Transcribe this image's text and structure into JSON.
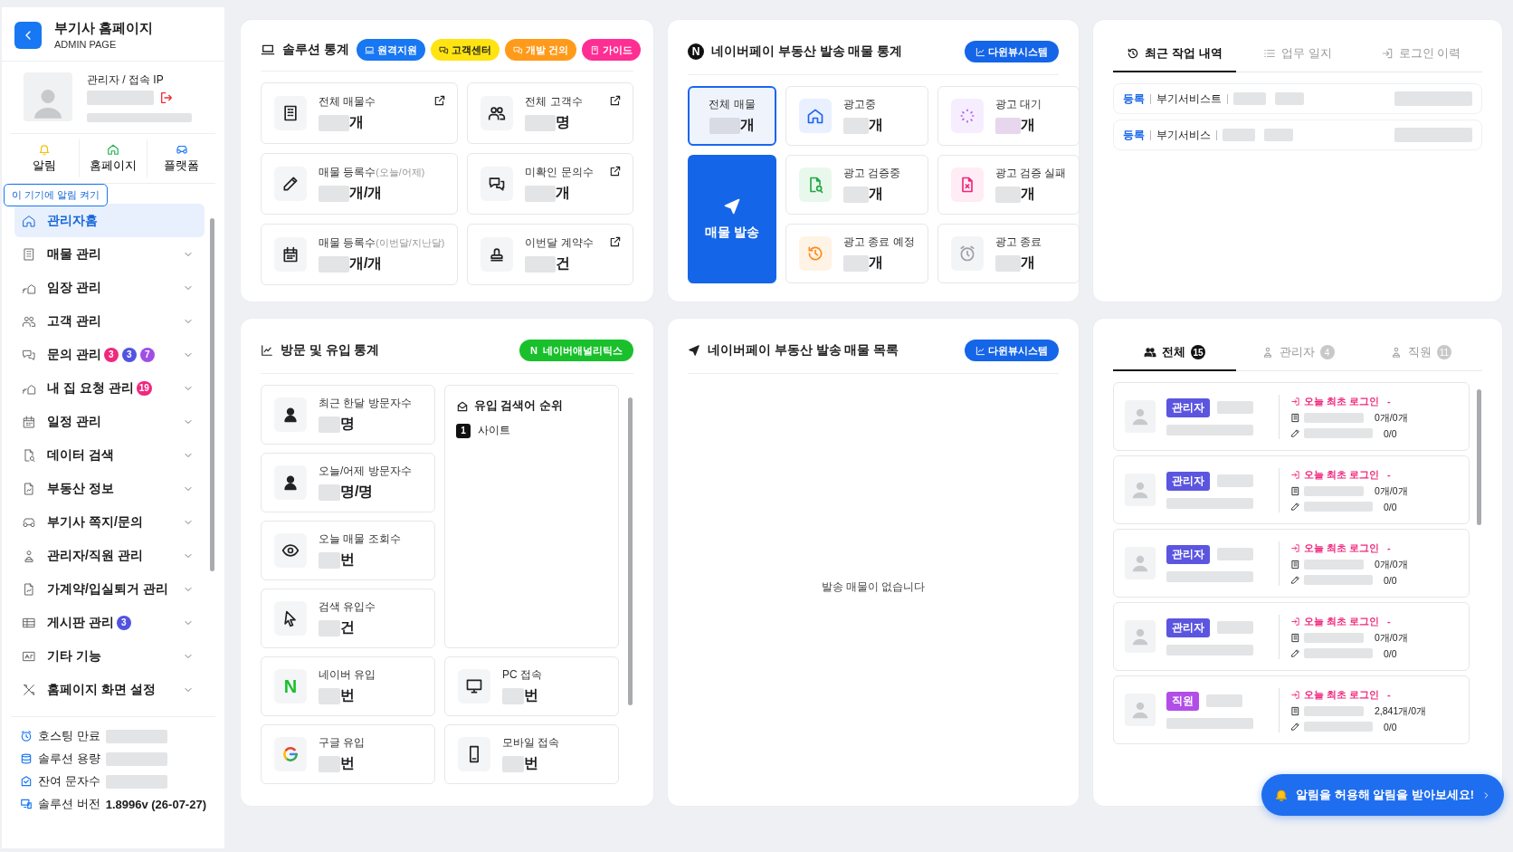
{
  "sidebar": {
    "title": "부기사 홈페이지",
    "subtitle": "ADMIN PAGE",
    "profile": {
      "label": "관리자 / 접속 IP"
    },
    "quick_nav": [
      {
        "label": "알림"
      },
      {
        "label": "홈페이지"
      },
      {
        "label": "플랫폼"
      }
    ],
    "tooltip": "이 기기에 알림 켜기",
    "items": [
      {
        "label": "관리자홈",
        "selected": true,
        "expandable": false
      },
      {
        "label": "매물 관리",
        "selected": false,
        "expandable": true
      },
      {
        "label": "임장 관리",
        "selected": false,
        "expandable": true
      },
      {
        "label": "고객 관리",
        "selected": false,
        "expandable": true
      },
      {
        "label": "문의 관리",
        "selected": false,
        "expandable": true,
        "badges": [
          {
            "count": "3",
            "color": "#f0287d"
          },
          {
            "count": "3",
            "color": "#5254e0"
          },
          {
            "count": "7",
            "color": "#a04ee6"
          }
        ]
      },
      {
        "label": "내 집 요청 관리",
        "selected": false,
        "expandable": true,
        "badges": [
          {
            "count": "19",
            "color": "#f0287d"
          }
        ]
      },
      {
        "label": "일정 관리",
        "selected": false,
        "expandable": true
      },
      {
        "label": "데이터 검색",
        "selected": false,
        "expandable": true
      },
      {
        "label": "부동산 정보",
        "selected": false,
        "expandable": true
      },
      {
        "label": "부기사 쪽지/문의",
        "selected": false,
        "expandable": true
      },
      {
        "label": "관리자/직원 관리",
        "selected": false,
        "expandable": true
      },
      {
        "label": "가계약/입실퇴거 관리",
        "selected": false,
        "expandable": true
      },
      {
        "label": "게시판 관리",
        "selected": false,
        "expandable": true,
        "badges": [
          {
            "count": "3",
            "color": "#5254e0"
          }
        ]
      },
      {
        "label": "기타 기능",
        "selected": false,
        "expandable": true
      },
      {
        "label": "홈페이지 화면 설정",
        "selected": false,
        "expandable": true
      }
    ],
    "info": [
      {
        "label": "호스팅 만료"
      },
      {
        "label": "솔루션 용량"
      },
      {
        "label": "잔여 문자수"
      },
      {
        "label": "솔루션 버전",
        "value": "1.8996v (26-07-27)"
      }
    ]
  },
  "solution_stats": {
    "title": "솔루션 통계",
    "buttons": [
      {
        "label": "원격지원",
        "color": "#1877f2"
      },
      {
        "label": "고객센터",
        "color": "#ffe411"
      },
      {
        "label": "개발 건의",
        "color": "#ff9a1a"
      },
      {
        "label": "가이드",
        "color": "#ff2e92"
      }
    ],
    "cards": [
      {
        "label": "전체 매물수",
        "unit": "개",
        "link": true
      },
      {
        "label": "전체 고객수",
        "unit": "명",
        "link": true
      },
      {
        "label": "매물 등록수",
        "sublabel": "(오늘/어제)",
        "unit": "개/개",
        "link": false
      },
      {
        "label": "미확인 문의수",
        "unit": "개",
        "link": true
      },
      {
        "label": "매물 등록수",
        "sublabel": "(이번달/지난달)",
        "unit": "개/개",
        "link": false
      },
      {
        "label": "이번달 계약수",
        "unit": "건",
        "link": true
      }
    ]
  },
  "naverpay_stats": {
    "logo": "N",
    "title": "네이버페이 부동산 발송 매물 통계",
    "button": "다윈뷰시스템",
    "total": {
      "label": "전체 매물",
      "unit": "개",
      "selected": true
    },
    "send_button": "매물 발송",
    "cards": [
      {
        "label": "광고중",
        "unit": "개",
        "selected": false
      },
      {
        "label": "광고 대기",
        "unit": "개",
        "selected": false
      },
      {
        "label": "광고 검증중",
        "unit": "개",
        "selected": false
      },
      {
        "label": "광고 검증 실패",
        "unit": "개",
        "selected": false
      },
      {
        "label": "광고 종료 예정",
        "unit": "개",
        "selected": false
      },
      {
        "label": "광고 종료",
        "unit": "개",
        "selected": false
      }
    ]
  },
  "activity": {
    "tabs": [
      {
        "label": "최근 작업 내역",
        "selected": true
      },
      {
        "label": "업무 일지",
        "selected": false
      },
      {
        "label": "로그인 이력",
        "selected": false
      }
    ],
    "rows": [
      {
        "action": "등록",
        "service": "부기서비스트"
      },
      {
        "action": "등록",
        "service": "부기서비스"
      }
    ]
  },
  "visit_stats": {
    "title": "방문 및 유입 통계",
    "button": {
      "logo": "N",
      "label": "네이버애널리틱스"
    },
    "cards": [
      {
        "label": "최근 한달 방문자수",
        "unit": "명"
      },
      {
        "label": "오늘/어제 방문자수",
        "unit": "명/명"
      },
      {
        "label": "오늘 매물 조회수",
        "unit": "번"
      },
      {
        "label": "검색 유입수",
        "unit": "건"
      },
      {
        "label": "네이버 유입",
        "unit": "번",
        "mark": "N"
      },
      {
        "label": "구글 유입",
        "unit": "번"
      }
    ],
    "keywords": {
      "title": "유입 검색어 순위",
      "items": [
        {
          "rank": "1",
          "label": "사이트"
        }
      ]
    },
    "device_cards": [
      {
        "label": "PC 접속",
        "unit": "번"
      },
      {
        "label": "모바일 접속",
        "unit": "번"
      }
    ]
  },
  "naverpay_list": {
    "title": "네이버페이 부동산 발송 매물 목록",
    "button": "다윈뷰시스템",
    "empty": "발송 매물이 없습니다"
  },
  "staff": {
    "tabs": [
      {
        "label": "전체",
        "count": "15",
        "selected": true
      },
      {
        "label": "관리자",
        "count": "4",
        "selected": false
      },
      {
        "label": "직원",
        "count": "11",
        "selected": false
      }
    ],
    "members": [
      {
        "role": "관리자",
        "color": "#5b55e0",
        "login": "오늘 최초 로그인",
        "time": "-",
        "listings": "0개/0개",
        "posts": "0/0"
      },
      {
        "role": "관리자",
        "color": "#5b55e0",
        "login": "오늘 최초 로그인",
        "time": "-",
        "listings": "0개/0개",
        "posts": "0/0"
      },
      {
        "role": "관리자",
        "color": "#5b55e0",
        "login": "오늘 최초 로그인",
        "time": "-",
        "listings": "0개/0개",
        "posts": "0/0"
      },
      {
        "role": "관리자",
        "color": "#5b55e0",
        "login": "오늘 최초 로그인",
        "time": "-",
        "listings": "0개/0개",
        "posts": "0/0"
      },
      {
        "role": "직원",
        "color": "#b24ee8",
        "login": "오늘 최초 로그인",
        "time": "-",
        "listings": "2,841개/0개",
        "posts": "0/0"
      }
    ]
  },
  "toast": {
    "text": "알림을 허용해 알림을 받아보세요!"
  }
}
